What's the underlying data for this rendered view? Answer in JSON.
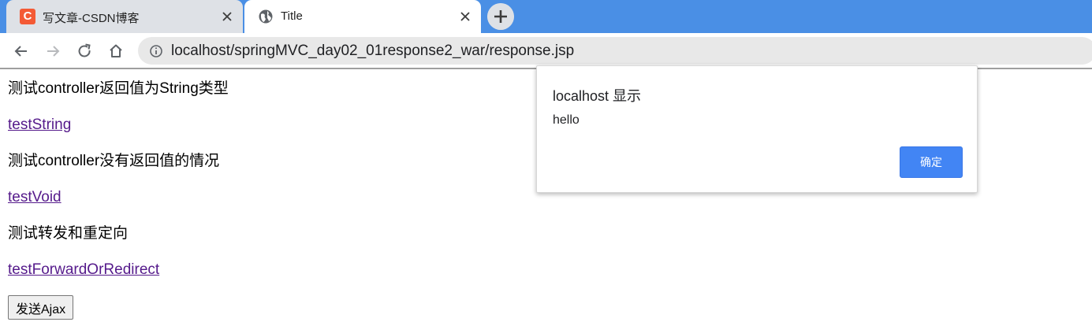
{
  "browser": {
    "tabs": [
      {
        "title": "写文章-CSDN博客",
        "favicon": "csdn-logo-icon",
        "favicon_text": "C",
        "active": false
      },
      {
        "title": "Title",
        "favicon": "globe-icon",
        "active": true
      }
    ],
    "address_bar": {
      "url": "localhost/springMVC_day02_01response2_war/response.jsp"
    }
  },
  "page": {
    "items": [
      {
        "kind": "text",
        "text": "测试controller返回值为String类型"
      },
      {
        "kind": "link",
        "text": "testString"
      },
      {
        "kind": "text",
        "text": "测试controller没有返回值的情况"
      },
      {
        "kind": "link",
        "text": "testVoid"
      },
      {
        "kind": "text",
        "text": "测试转发和重定向"
      },
      {
        "kind": "link",
        "text": "testForwardOrRedirect"
      }
    ],
    "ajax_button": "发送Ajax"
  },
  "alert": {
    "origin": "localhost 显示",
    "message": "hello",
    "ok_label": "确定"
  },
  "colors": {
    "tabstrip": "#4a8fe5",
    "link_visited": "#551a8b",
    "dialog_button": "#4285f4",
    "csdn_brand": "#f45a35"
  }
}
